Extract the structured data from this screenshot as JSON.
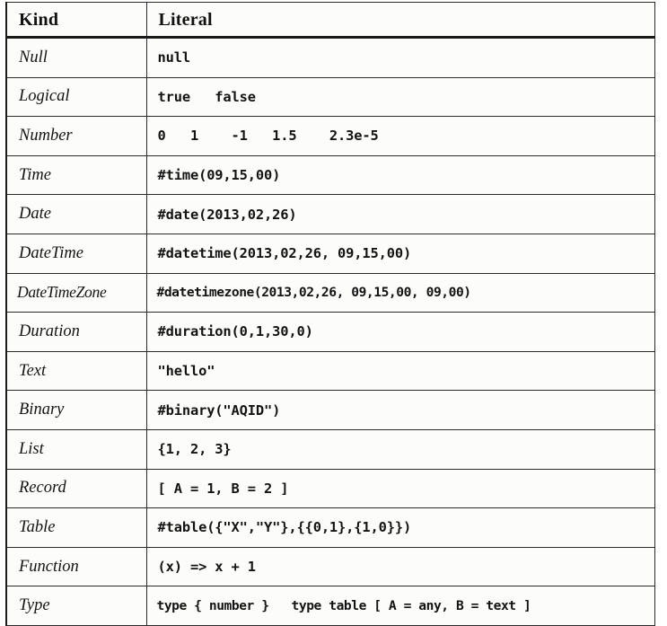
{
  "table": {
    "headers": {
      "kind": "Kind",
      "literal": "Literal"
    },
    "rows": [
      {
        "kind": "Null",
        "literal": "null"
      },
      {
        "kind": "Logical",
        "literal": "true   false"
      },
      {
        "kind": "Number",
        "literal": "0   1    -1   1.5    2.3e-5"
      },
      {
        "kind": "Time",
        "literal": "#time(09,15,00)"
      },
      {
        "kind": "Date",
        "literal": "#date(2013,02,26)"
      },
      {
        "kind": "DateTime",
        "literal": "#datetime(2013,02,26, 09,15,00)"
      },
      {
        "kind": "DateTimeZone",
        "literal": "#datetimezone(2013,02,26, 09,15,00, 09,00)"
      },
      {
        "kind": "Duration",
        "literal": "#duration(0,1,30,0)"
      },
      {
        "kind": "Text",
        "literal": "\"hello\""
      },
      {
        "kind": "Binary",
        "literal": "#binary(\"AQID\")"
      },
      {
        "kind": "List",
        "literal": "{1, 2, 3}"
      },
      {
        "kind": "Record",
        "literal": "[ A = 1, B = 2 ]"
      },
      {
        "kind": "Table",
        "literal": "#table({\"X\",\"Y\"},{{0,1},{1,0}})"
      },
      {
        "kind": "Function",
        "literal": "(x) => x + 1"
      },
      {
        "kind": "Type",
        "literal": "type { number }   type table [ A = any, B = text ]"
      }
    ]
  },
  "colors": {
    "border": "#2a2a2a",
    "header_rule": "#1a1a1a",
    "text": "#131313",
    "background": "#fcfcfa"
  }
}
